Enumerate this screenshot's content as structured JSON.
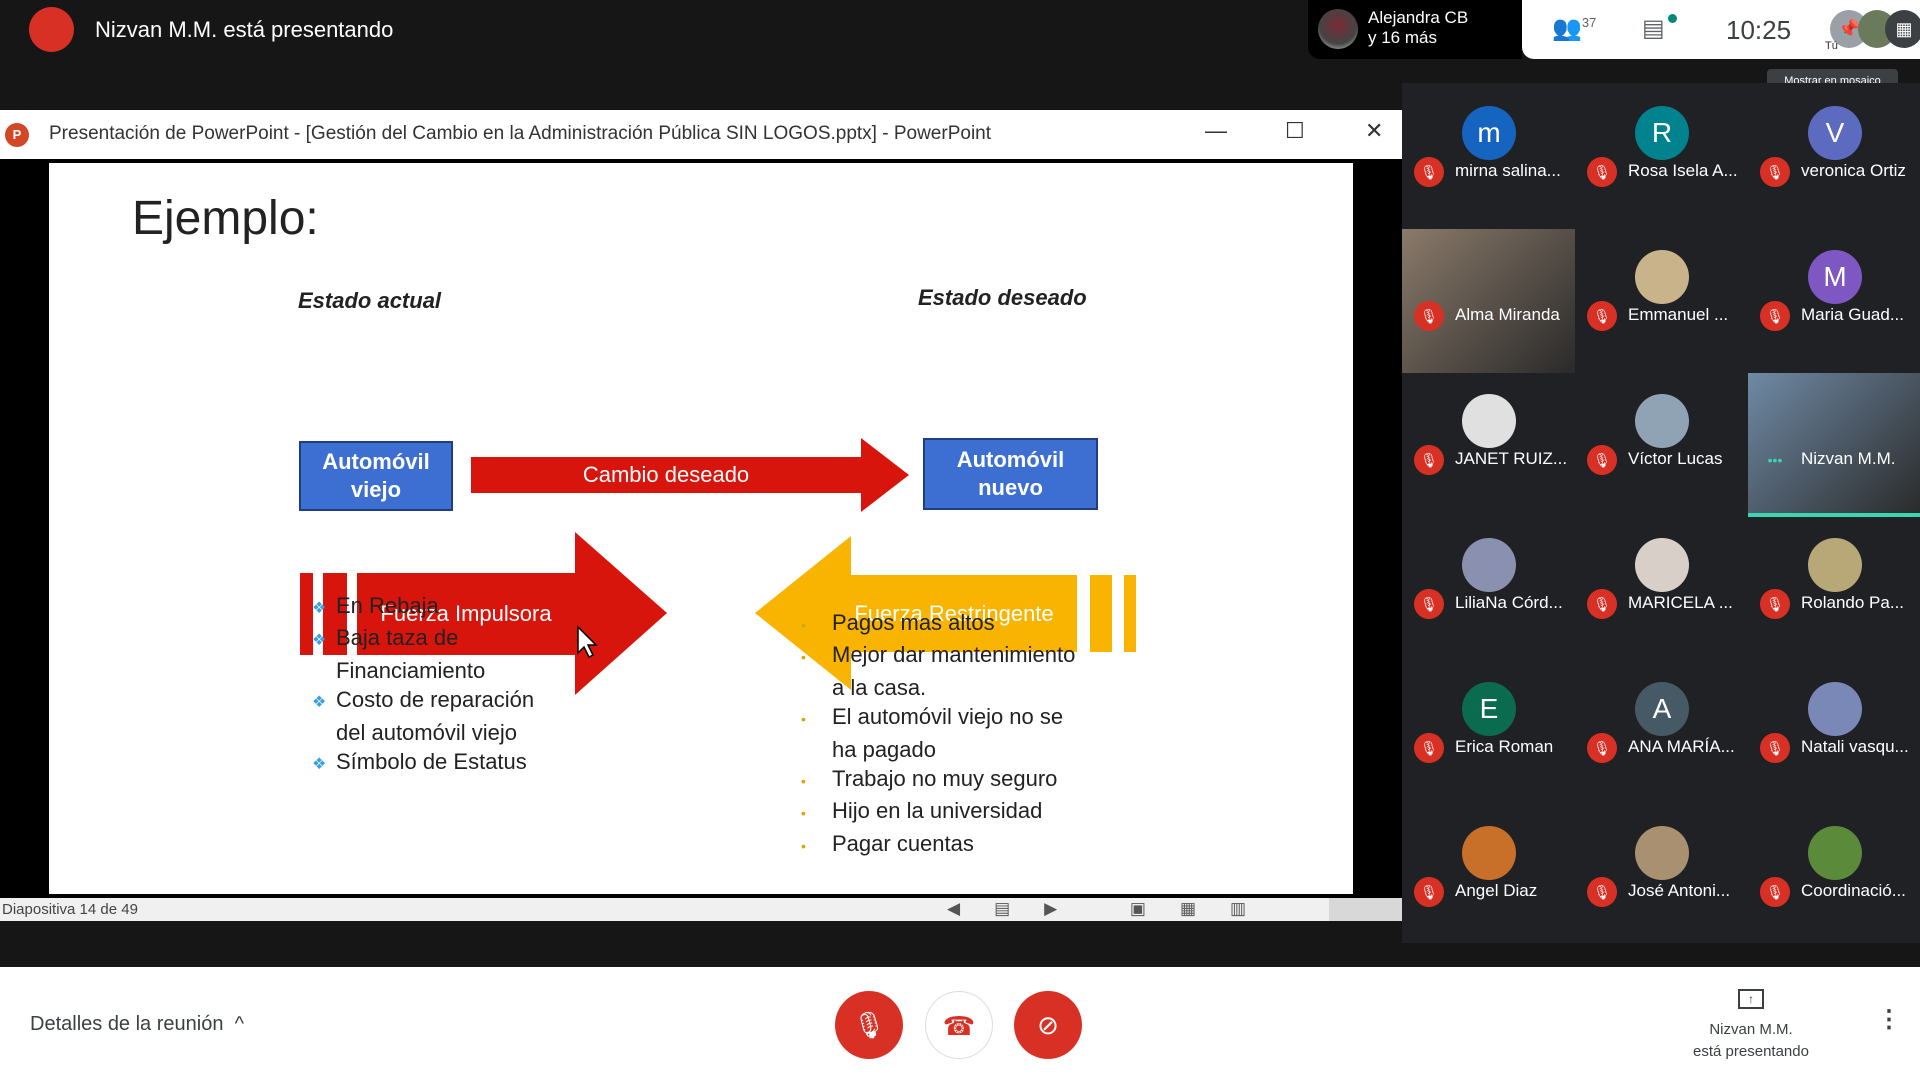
{
  "top": {
    "presenting": "Nizvan M.M. está presentando",
    "speaker": "Alejandra CB",
    "speaker_more": "y 16 más",
    "participants_count": "37",
    "time": "10:25",
    "self_label": "Tú",
    "tooltip": "Mostrar en mosaico"
  },
  "ppt": {
    "window_title": "Presentación de PowerPoint - [Gestión del Cambio en la Administración Pública SIN LOGOS.pptx] - PowerPoint",
    "status": "Diapositiva 14 de 49",
    "slide": {
      "title": "Ejemplo:",
      "current_state_label": "Estado actual",
      "desired_state_label": "Estado deseado",
      "current_box": [
        "Automóvil",
        "viejo"
      ],
      "desired_box": [
        "Automóvil",
        "nuevo"
      ],
      "change_arrow": "Cambio deseado",
      "driving_force": "Fuerza Impulsora",
      "restraining_force": "Fuerza Restringente",
      "driving_items": [
        "En Rebaja",
        "Baja taza de",
        "Financiamiento",
        "Costo de reparación",
        "del automóvil viejo",
        "Símbolo de Estatus"
      ],
      "restraining_items": [
        "Pagos mas altos",
        "Mejor dar mantenimiento",
        "a la casa.",
        "El automóvil viejo no se",
        "ha pagado",
        "Trabajo no muy seguro",
        "Hijo en la universidad",
        "Pagar cuentas"
      ],
      "colors": {
        "box": "#3c6fd1",
        "red": "#d8150c",
        "yellow": "#f8b400",
        "bullet": "#3aa0e0"
      }
    }
  },
  "participants": [
    {
      "name": "mirna salina...",
      "initial": "m",
      "color": "#1565c0"
    },
    {
      "name": "Rosa Isela A...",
      "initial": "R",
      "color": "#00838f"
    },
    {
      "name": "veronica Ortiz",
      "initial": "V",
      "color": "#5c6bc0"
    },
    {
      "name": "Alma Miranda",
      "initial": "",
      "color": "#8a7a6a",
      "video": true
    },
    {
      "name": "Emmanuel ...",
      "initial": "",
      "color": "#c9b38a"
    },
    {
      "name": "Maria Guad...",
      "initial": "M",
      "color": "#7e57c2"
    },
    {
      "name": "JANET RUIZ...",
      "initial": "",
      "color": "#e0e0e0"
    },
    {
      "name": "Víctor Lucas",
      "initial": "",
      "color": "#8fa3b5"
    },
    {
      "name": "Nizvan M.M.",
      "initial": "",
      "color": "#6f8aa5",
      "video": true,
      "speaking": true
    },
    {
      "name": "LiliaNa Córd...",
      "initial": "",
      "color": "#8a90b0"
    },
    {
      "name": "MARICELA ...",
      "initial": "",
      "color": "#d8d0c8"
    },
    {
      "name": "Rolando Pa...",
      "initial": "",
      "color": "#b8a878"
    },
    {
      "name": "Erica Roman",
      "initial": "E",
      "color": "#0b6b4f"
    },
    {
      "name": "ANA MARÍA...",
      "initial": "A",
      "color": "#455a64"
    },
    {
      "name": "Natali vasqu...",
      "initial": "",
      "color": "#7a88b8"
    },
    {
      "name": "Angel Diaz",
      "initial": "",
      "color": "#c8702a"
    },
    {
      "name": "José Antoni...",
      "initial": "",
      "color": "#a89070"
    },
    {
      "name": "Coordinació...",
      "initial": "",
      "color": "#5a8a3a"
    }
  ],
  "bottom": {
    "details": "Detalles de la reunión",
    "presenter": "Nizvan M.M.",
    "presenter_status": "está presentando"
  }
}
